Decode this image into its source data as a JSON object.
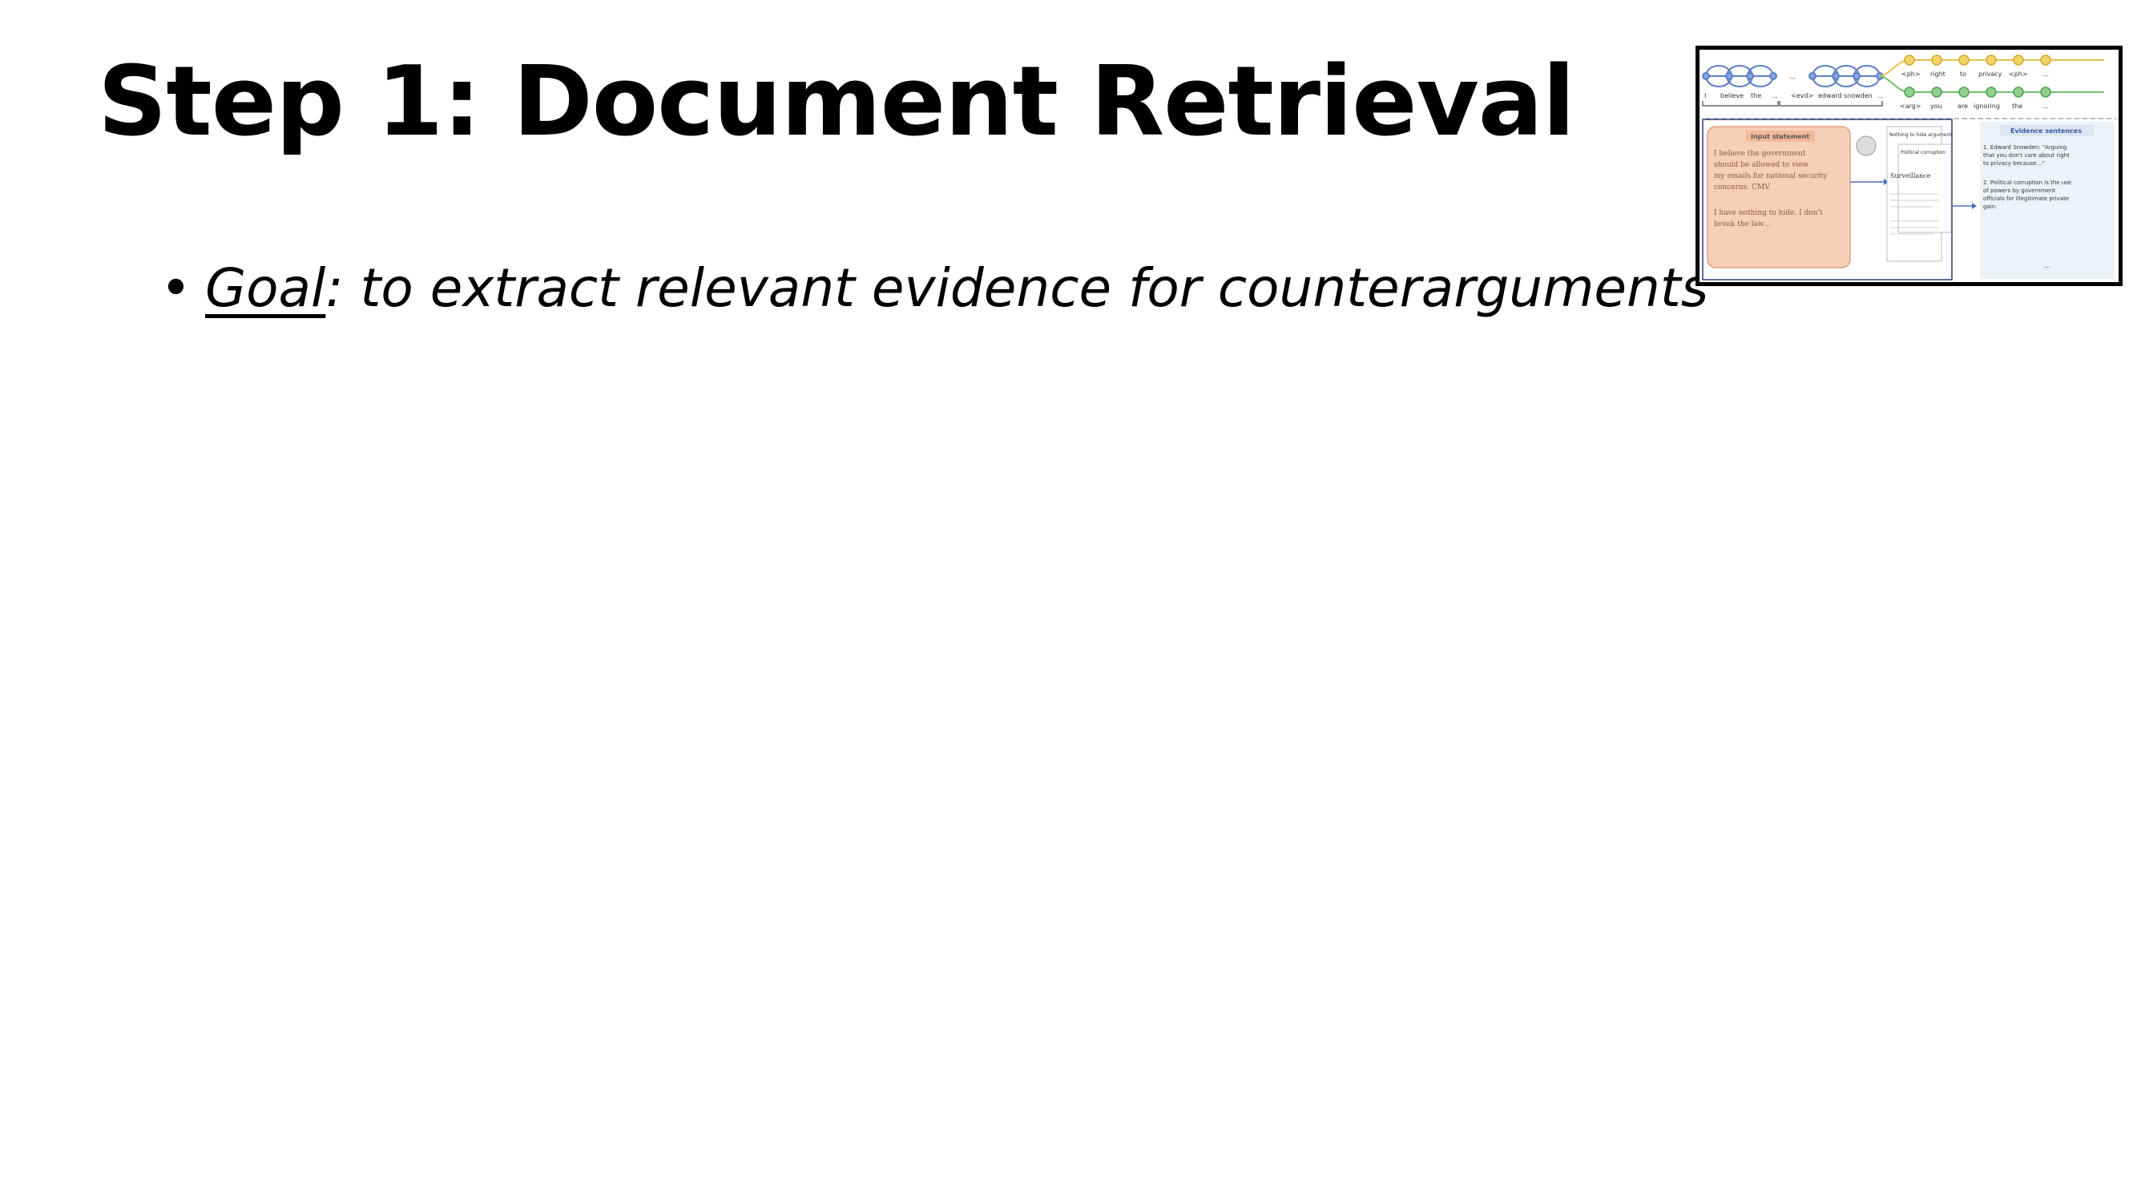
{
  "slide": {
    "title": "Step 1: Document Retrieval",
    "bullet": {
      "term": "Goal",
      "text": ": to extract relevant evidence for counterarguments"
    }
  },
  "thumbnail": {
    "encoder_tokens": [
      "I",
      "believe",
      "the",
      "…",
      "<evd>",
      "edward",
      "snowden",
      "…"
    ],
    "decoder_top_tokens": [
      "<ph>",
      "right",
      "to",
      "privacy",
      "<ph>",
      "…"
    ],
    "decoder_bottom_tokens": [
      "<arg>",
      "you",
      "are",
      "ignoring",
      "the",
      "…"
    ],
    "input_statement": {
      "label": "Input statement",
      "lines": [
        "I believe the government",
        "should be allowed to view",
        "my emails for national security",
        "concerns. CMV.",
        "I have nothing to hide. I don't",
        "break the law…"
      ]
    },
    "wiki_cards": {
      "card1_title": "Nothing to hide argument",
      "card2_title": "Political corruption",
      "card3_title": "Surveillance"
    },
    "evidence": {
      "label": "Evidence sentences",
      "items": [
        "1. Edward Snowden: \"Arguing",
        "that you don't care about right",
        "to privacy because…\"",
        "2. Political corruption is the use",
        "of powers by government",
        "officials for illegitimate private",
        "gain."
      ],
      "more": "…"
    },
    "colors": {
      "encoder": "#5b7fc7",
      "decoder_top": "#e8c34a",
      "decoder_bottom": "#6cbf6c",
      "input_box": "#f6cfb8",
      "evidence_box": "#dde6f2"
    }
  }
}
